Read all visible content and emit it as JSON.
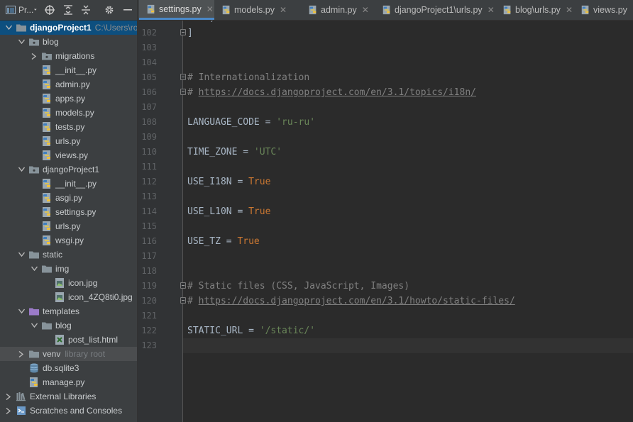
{
  "toolbar": {
    "project_label": "Pr...",
    "icons": [
      "project-view-icon",
      "chevron-down-icon",
      "crosshair-icon",
      "expand-all-icon",
      "collapse-all-icon",
      "gear-icon",
      "minimize-icon"
    ]
  },
  "tabs": [
    {
      "label": "settings.py",
      "active": true
    },
    {
      "label": "models.py",
      "active": false
    },
    {
      "label": "admin.py",
      "active": false
    },
    {
      "label": "djangoProject1\\urls.py",
      "active": false
    },
    {
      "label": "blog\\urls.py",
      "active": false
    },
    {
      "label": "views.py",
      "active": false
    }
  ],
  "tree": [
    {
      "label": "djangoProject1",
      "hint": "C:\\Users\\ro",
      "icon": "folder-icon",
      "level": 0,
      "expanded": true,
      "selected": true
    },
    {
      "label": "blog",
      "icon": "package-icon",
      "level": 1,
      "expanded": true
    },
    {
      "label": "migrations",
      "icon": "package-icon",
      "level": 2,
      "expanded": false
    },
    {
      "label": "__init__.py",
      "icon": "python-file-icon",
      "level": 2
    },
    {
      "label": "admin.py",
      "icon": "python-file-icon",
      "level": 2
    },
    {
      "label": "apps.py",
      "icon": "python-file-icon",
      "level": 2
    },
    {
      "label": "models.py",
      "icon": "python-file-icon",
      "level": 2
    },
    {
      "label": "tests.py",
      "icon": "python-file-icon",
      "level": 2
    },
    {
      "label": "urls.py",
      "icon": "python-file-icon",
      "level": 2
    },
    {
      "label": "views.py",
      "icon": "python-file-icon",
      "level": 2
    },
    {
      "label": "djangoProject1",
      "icon": "package-icon",
      "level": 1,
      "expanded": true
    },
    {
      "label": "__init__.py",
      "icon": "python-file-icon",
      "level": 2
    },
    {
      "label": "asgi.py",
      "icon": "python-file-icon",
      "level": 2
    },
    {
      "label": "settings.py",
      "icon": "python-file-icon",
      "level": 2
    },
    {
      "label": "urls.py",
      "icon": "python-file-icon",
      "level": 2
    },
    {
      "label": "wsgi.py",
      "icon": "python-file-icon",
      "level": 2
    },
    {
      "label": "static",
      "icon": "folder-icon",
      "level": 1,
      "expanded": true
    },
    {
      "label": "img",
      "icon": "folder-icon",
      "level": 2,
      "expanded": true
    },
    {
      "label": "icon.jpg",
      "icon": "image-file-icon",
      "level": 3
    },
    {
      "label": "icon_4ZQ8ti0.jpg",
      "icon": "image-file-icon",
      "level": 3
    },
    {
      "label": "templates",
      "icon": "templates-folder-icon",
      "level": 1,
      "expanded": true
    },
    {
      "label": "blog",
      "icon": "folder-icon",
      "level": 2,
      "expanded": true
    },
    {
      "label": "post_list.html",
      "icon": "html-file-icon",
      "level": 3
    },
    {
      "label": "venv",
      "hint": "library root",
      "icon": "folder-icon",
      "level": 1,
      "expanded": false,
      "hover": true
    },
    {
      "label": "db.sqlite3",
      "icon": "database-icon",
      "level": 1
    },
    {
      "label": "manage.py",
      "icon": "python-file-icon",
      "level": 1
    },
    {
      "label": "External Libraries",
      "icon": "libraries-icon",
      "level": 0,
      "expanded": false
    },
    {
      "label": "Scratches and Consoles",
      "icon": "scratches-icon",
      "level": 0,
      "expanded": false
    }
  ],
  "editor": {
    "top_partial_line": {
      "num": "101",
      "text": "    )"
    },
    "current_line": "123",
    "lines": [
      {
        "num": "102",
        "fold": true,
        "tokens": [
          {
            "t": "]",
            "c": ""
          }
        ]
      },
      {
        "num": "103",
        "tokens": []
      },
      {
        "num": "104",
        "tokens": []
      },
      {
        "num": "105",
        "fold": true,
        "tokens": [
          {
            "t": "# Internationalization",
            "c": "cmt"
          }
        ]
      },
      {
        "num": "106",
        "fold": true,
        "tokens": [
          {
            "t": "# ",
            "c": "cmt"
          },
          {
            "t": "https://docs.djangoproject.com/en/3.1/topics/i18n/",
            "c": "url"
          }
        ]
      },
      {
        "num": "107",
        "tokens": []
      },
      {
        "num": "108",
        "tokens": [
          {
            "t": "LANGUAGE_CODE = ",
            "c": ""
          },
          {
            "t": "'ru-ru'",
            "c": "str"
          }
        ]
      },
      {
        "num": "109",
        "tokens": []
      },
      {
        "num": "110",
        "tokens": [
          {
            "t": "TIME_ZONE = ",
            "c": ""
          },
          {
            "t": "'UTC'",
            "c": "str"
          }
        ]
      },
      {
        "num": "111",
        "tokens": []
      },
      {
        "num": "112",
        "tokens": [
          {
            "t": "USE_I18N = ",
            "c": ""
          },
          {
            "t": "True",
            "c": "kw"
          }
        ]
      },
      {
        "num": "113",
        "tokens": []
      },
      {
        "num": "114",
        "tokens": [
          {
            "t": "USE_L10N = ",
            "c": ""
          },
          {
            "t": "True",
            "c": "kw"
          }
        ]
      },
      {
        "num": "115",
        "tokens": []
      },
      {
        "num": "116",
        "tokens": [
          {
            "t": "USE_TZ = ",
            "c": ""
          },
          {
            "t": "True",
            "c": "kw"
          }
        ]
      },
      {
        "num": "117",
        "tokens": []
      },
      {
        "num": "118",
        "tokens": []
      },
      {
        "num": "119",
        "fold": true,
        "tokens": [
          {
            "t": "# Static files (CSS, JavaScript, Images)",
            "c": "cmt"
          }
        ]
      },
      {
        "num": "120",
        "fold": true,
        "tokens": [
          {
            "t": "# ",
            "c": "cmt"
          },
          {
            "t": "https://docs.djangoproject.com/en/3.1/howto/static-files/",
            "c": "url"
          }
        ]
      },
      {
        "num": "121",
        "tokens": []
      },
      {
        "num": "122",
        "tokens": [
          {
            "t": "STATIC_URL = ",
            "c": ""
          },
          {
            "t": "'/static/'",
            "c": "str"
          }
        ]
      },
      {
        "num": "123",
        "tokens": []
      }
    ]
  },
  "colors": {
    "background": "#2b2b2b",
    "panel": "#3c3f41",
    "selection": "#0d4f7f",
    "tab_underline": "#4a88c7",
    "comment": "#808080",
    "string": "#6a8759",
    "keyword": "#cc7832",
    "text": "#a9b7c6"
  }
}
